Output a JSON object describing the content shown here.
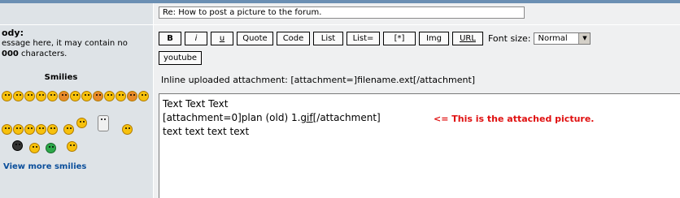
{
  "left_panel": {
    "body_label": "ody:",
    "body_desc_line1": "essage here, it may contain no",
    "body_desc_line2_bold": "000",
    "body_desc_line2_rest": " characters.",
    "smilies_title": "Smilies",
    "view_more": "View more smilies"
  },
  "subject": {
    "value": "Re: How to post a picture to the forum."
  },
  "toolbar": {
    "buttons": [
      "B",
      "i",
      "u",
      "Quote",
      "Code",
      "List",
      "List=",
      "[*]",
      "Img",
      "URL"
    ],
    "font_size_label": "Font size:",
    "font_size_value": "Normal",
    "youtube": "youtube"
  },
  "inline_info": "Inline uploaded attachment: [attachment=]filename.ext[/attachment]",
  "editor": {
    "line1": "Text Text Text",
    "line2_prefix": "[attachment=0]plan (old) 1.",
    "line2_ext": "gif",
    "line2_suffix": "[/attachment]",
    "line3": "text text text text",
    "note": "<= This is the attached picture."
  },
  "colors": {
    "left_bg": "#dee3e7",
    "right_bg": "#eff0f1",
    "link": "#0a4e9b",
    "note_red": "#e01010"
  }
}
